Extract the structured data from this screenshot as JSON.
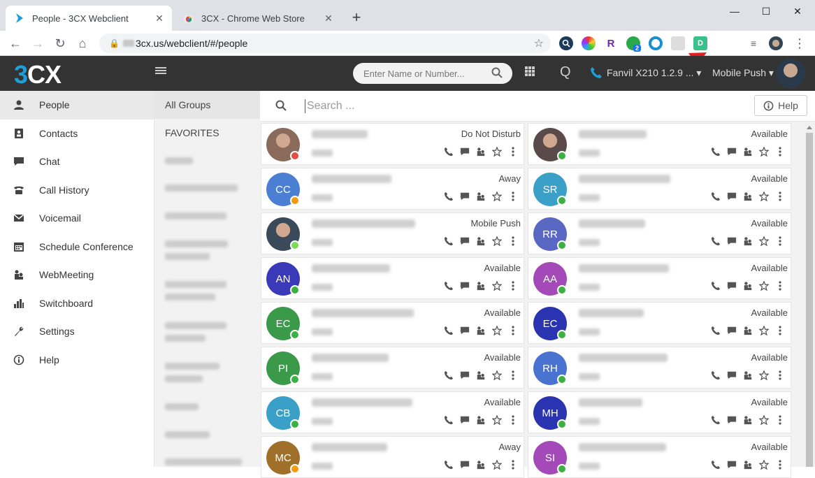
{
  "browser": {
    "tabs": [
      {
        "title": "People - 3CX Webclient",
        "active": true
      },
      {
        "title": "3CX - Chrome Web Store",
        "active": false
      }
    ],
    "new_tab": "+",
    "window_controls": {
      "minimize": "—",
      "maximize": "☐",
      "close": "✕"
    },
    "url": "3cx.us/webclient/#/people"
  },
  "app": {
    "logo_a": "3",
    "logo_b": "CX",
    "dial_placeholder": "Enter Name or Number...",
    "queue_label": "Q",
    "phone_label": "Fanvil X210 1.2.9 ...",
    "push_label": "Mobile Push",
    "accent": "#1e9fd9"
  },
  "sidebar": {
    "items": [
      {
        "label": "People",
        "icon": "person-icon"
      },
      {
        "label": "Contacts",
        "icon": "contacts-icon"
      },
      {
        "label": "Chat",
        "icon": "chat-icon"
      },
      {
        "label": "Call History",
        "icon": "phone-history-icon"
      },
      {
        "label": "Voicemail",
        "icon": "voicemail-icon"
      },
      {
        "label": "Schedule Conference",
        "icon": "calendar-icon"
      },
      {
        "label": "WebMeeting",
        "icon": "webmeeting-icon"
      },
      {
        "label": "Switchboard",
        "icon": "bar-chart-icon"
      },
      {
        "label": "Settings",
        "icon": "wrench-icon"
      },
      {
        "label": "Help",
        "icon": "info-icon"
      }
    ]
  },
  "groups": {
    "all": "All Groups",
    "favorites": "FAVORITES"
  },
  "main": {
    "search_placeholder": "Search ...",
    "help_label": "Help"
  },
  "contacts": [
    {
      "initials": "",
      "status": "Do Not Disturb",
      "presence": "#e54d42",
      "bg": "#8a6a5a",
      "photo": true
    },
    {
      "initials": "",
      "status": "Available",
      "presence": "#3cb043",
      "bg": "#5a4a4a",
      "photo": true
    },
    {
      "initials": "CC",
      "status": "Away",
      "presence": "#f39c12",
      "bg": "#4a7fd4"
    },
    {
      "initials": "SR",
      "status": "Available",
      "presence": "#3cb043",
      "bg": "#3aa0c8"
    },
    {
      "initials": "",
      "status": "Mobile Push",
      "presence": "#7ed957",
      "bg": "#3a4a5a",
      "photo": true
    },
    {
      "initials": "RR",
      "status": "Available",
      "presence": "#3cb043",
      "bg": "#5a68c4"
    },
    {
      "initials": "AN",
      "status": "Available",
      "presence": "#3cb043",
      "bg": "#3a3ab8"
    },
    {
      "initials": "AA",
      "status": "Available",
      "presence": "#3cb043",
      "bg": "#a44ab8"
    },
    {
      "initials": "EC",
      "status": "Available",
      "presence": "#3cb043",
      "bg": "#3a9a4a"
    },
    {
      "initials": "EC",
      "status": "Available",
      "presence": "#3cb043",
      "bg": "#2a34b0"
    },
    {
      "initials": "PI",
      "status": "Available",
      "presence": "#3cb043",
      "bg": "#3a9a4a"
    },
    {
      "initials": "RH",
      "status": "Available",
      "presence": "#3cb043",
      "bg": "#4a72d0"
    },
    {
      "initials": "CB",
      "status": "Available",
      "presence": "#3cb043",
      "bg": "#3aa0c8"
    },
    {
      "initials": "MH",
      "status": "Available",
      "presence": "#3cb043",
      "bg": "#2a34b0"
    },
    {
      "initials": "MC",
      "status": "Away",
      "presence": "#f39c12",
      "bg": "#a0702a"
    },
    {
      "initials": "SI",
      "status": "Available",
      "presence": "#3cb043",
      "bg": "#a44ab8"
    }
  ]
}
